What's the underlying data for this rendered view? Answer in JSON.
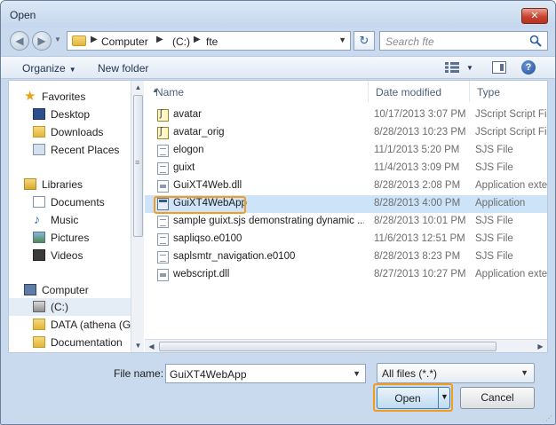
{
  "window": {
    "title": "Open",
    "close_glyph": "✕"
  },
  "nav": {
    "back_glyph": "◀",
    "forward_glyph": "▶"
  },
  "address": {
    "breadcrumb": [
      {
        "label": "Computer"
      },
      {
        "label": "(C:)"
      },
      {
        "label": "fte"
      }
    ],
    "separator": "▶",
    "refresh_glyph": "↻"
  },
  "search": {
    "placeholder": "Search fte"
  },
  "toolbar": {
    "organize_label": "Organize",
    "new_folder_label": "New folder",
    "help_glyph": "?"
  },
  "sidebar": {
    "items": [
      {
        "label": "Favorites",
        "icon": "star-icon"
      },
      {
        "label": "Desktop",
        "icon": "desktop-icon"
      },
      {
        "label": "Downloads",
        "icon": "downloads-folder-icon"
      },
      {
        "label": "Recent Places",
        "icon": "recent-places-icon"
      },
      {
        "label": "Libraries",
        "icon": "libraries-icon"
      },
      {
        "label": "Documents",
        "icon": "documents-icon"
      },
      {
        "label": "Music",
        "icon": "music-icon"
      },
      {
        "label": "Pictures",
        "icon": "pictures-icon"
      },
      {
        "label": "Videos",
        "icon": "videos-icon"
      },
      {
        "label": "Computer",
        "icon": "computer-icon"
      },
      {
        "label": "(C:)",
        "icon": "drive-icon",
        "selected": true
      },
      {
        "label": "DATA (athena (G",
        "icon": "network-drive-icon"
      },
      {
        "label": "Documentation",
        "icon": "folder-icon"
      }
    ]
  },
  "columns": {
    "name": "Name",
    "date": "Date modified",
    "type": "Type"
  },
  "files": [
    {
      "name": "avatar",
      "date": "10/17/2013 3:07 PM",
      "type": "JScript Script File",
      "icon": "jscript-file-icon"
    },
    {
      "name": "avatar_orig",
      "date": "8/28/2013 10:23 PM",
      "type": "JScript Script File",
      "icon": "jscript-file-icon"
    },
    {
      "name": "elogon",
      "date": "11/1/2013 5:20 PM",
      "type": "SJS File",
      "icon": "sjs-file-icon"
    },
    {
      "name": "guixt",
      "date": "11/4/2013 3:09 PM",
      "type": "SJS File",
      "icon": "sjs-file-icon"
    },
    {
      "name": "GuiXT4Web.dll",
      "date": "8/28/2013 2:08 PM",
      "type": "Application exten",
      "icon": "dll-file-icon"
    },
    {
      "name": "GuiXT4WebApp",
      "date": "8/28/2013 4:00 PM",
      "type": "Application",
      "icon": "application-icon",
      "selected": true
    },
    {
      "name": "sample guixt.sjs demonstrating dynamic ...",
      "date": "8/28/2013 10:01 PM",
      "type": "SJS File",
      "icon": "sjs-file-icon"
    },
    {
      "name": "sapliqso.e0100",
      "date": "11/6/2013 12:51 PM",
      "type": "SJS File",
      "icon": "sjs-file-icon"
    },
    {
      "name": "saplsmtr_navigation.e0100",
      "date": "8/28/2013 8:23 PM",
      "type": "SJS File",
      "icon": "sjs-file-icon"
    },
    {
      "name": "webscript.dll",
      "date": "8/27/2013 10:27 PM",
      "type": "Application exten",
      "icon": "dll-file-icon"
    }
  ],
  "bottom": {
    "file_name_label": "File name:",
    "file_name_value": "GuiXT4WebApp",
    "filter_value": "All files (*.*)",
    "open_label": "Open",
    "cancel_label": "Cancel"
  },
  "colors": {
    "highlight": "#f39c1d",
    "selection": "#cde3f7",
    "window_frame": "#c9daee"
  }
}
